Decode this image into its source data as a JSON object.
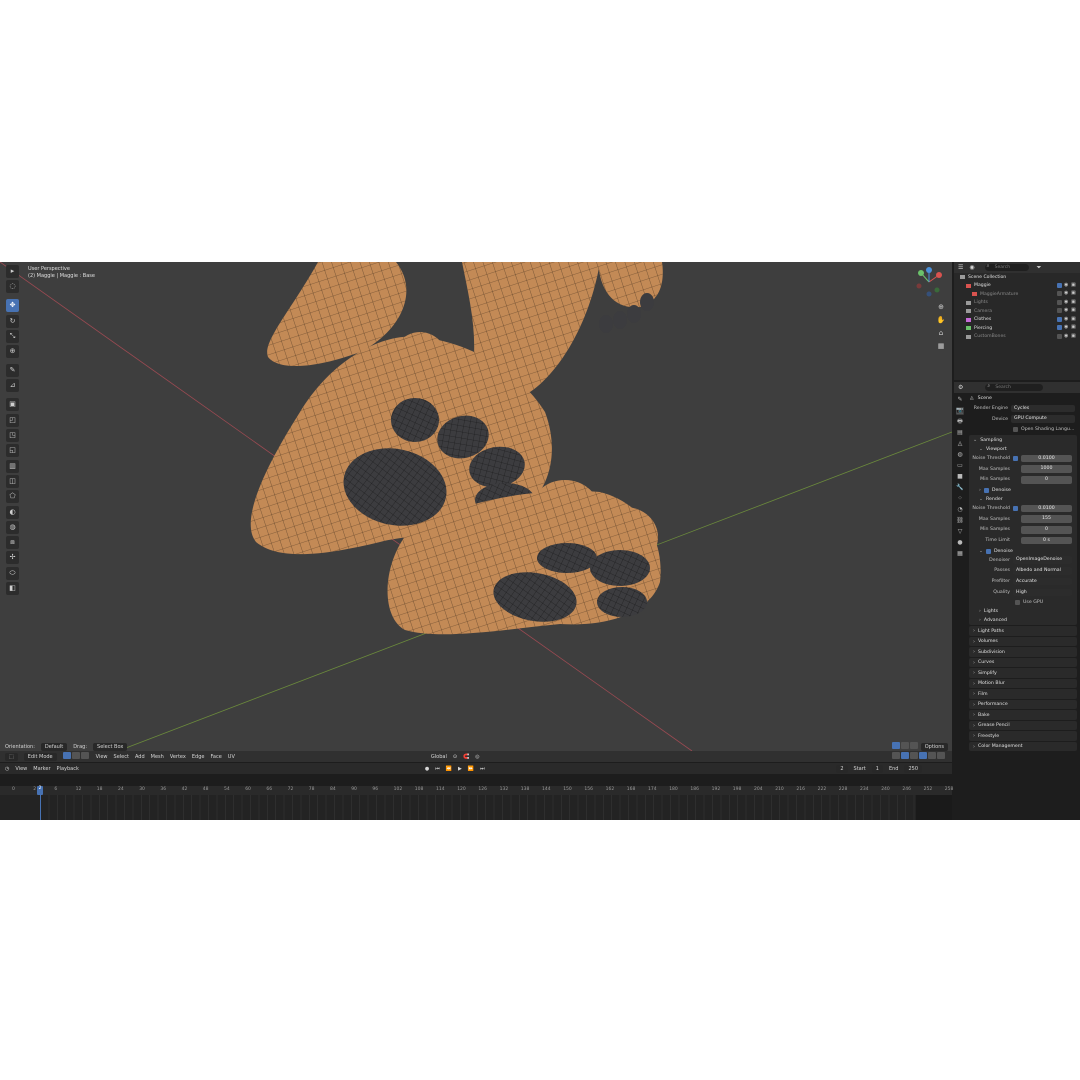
{
  "viewport": {
    "info_line1": "User Perspective",
    "info_line2": "(2) Maggie | Maggie : Base",
    "tools": [
      "cursor-icon",
      "circle-select-icon",
      "move-icon",
      "rotate-icon",
      "scale-icon",
      "transform-icon",
      "annotate-icon",
      "measure-icon",
      "add-cube-icon",
      "extrude-icon",
      "inset-icon",
      "bevel-icon",
      "loop-cut-icon",
      "knife-icon",
      "poly-build-icon",
      "spin-icon",
      "smooth-icon",
      "edge-slide-icon",
      "shrink-fatten-icon",
      "shear-icon",
      "rip-icon"
    ],
    "gizmo_axes": [
      "X",
      "Y",
      "Z"
    ]
  },
  "header": {
    "orientation_label": "Orientation:",
    "orientation_value": "Default",
    "drag_label": "Drag:",
    "drag_value": "Select Box",
    "options": "Options"
  },
  "edit_header": {
    "mode": "Edit Mode",
    "menus": [
      "View",
      "Select",
      "Add",
      "Mesh",
      "Vertex",
      "Edge",
      "Face",
      "UV"
    ],
    "transform_orientation": "Global"
  },
  "timeline_header": {
    "menus": [
      "View",
      "Marker",
      "Playback"
    ],
    "current_frame": "2",
    "start_label": "Start",
    "start_value": "1",
    "end_label": "End",
    "end_value": "250"
  },
  "ruler": {
    "current": "2",
    "labels": [
      "0",
      "2",
      "6",
      "12",
      "18",
      "24",
      "30",
      "36",
      "42",
      "48",
      "54",
      "60",
      "66",
      "72",
      "78",
      "84",
      "90",
      "96",
      "102",
      "108",
      "114",
      "120",
      "126",
      "132",
      "138",
      "144",
      "150",
      "156",
      "162",
      "168",
      "174",
      "180",
      "186",
      "192",
      "198",
      "204",
      "210",
      "216",
      "222",
      "228",
      "234",
      "240",
      "246",
      "252",
      "258"
    ]
  },
  "outliner": {
    "search_placeholder": "Search",
    "items": [
      {
        "label": "Scene Collection",
        "indent": 0,
        "dim": false,
        "color": "#9a9a9a"
      },
      {
        "label": "Maggie",
        "indent": 1,
        "dim": false,
        "color": "#d9534f"
      },
      {
        "label": "MaggieArmature",
        "indent": 2,
        "dim": true,
        "color": "#d9534f"
      },
      {
        "label": "Lights",
        "indent": 1,
        "dim": true,
        "color": "#9a9a9a"
      },
      {
        "label": "Camera",
        "indent": 1,
        "dim": true,
        "color": "#9a9a9a"
      },
      {
        "label": "Clothes",
        "indent": 1,
        "dim": false,
        "color": "#c86bd9"
      },
      {
        "label": "Piercing",
        "indent": 1,
        "dim": false,
        "color": "#6bc26b"
      },
      {
        "label": "CustomBones",
        "indent": 1,
        "dim": true,
        "color": "#9a9a9a"
      }
    ]
  },
  "properties": {
    "search_placeholder": "Search",
    "scene_label": "Scene",
    "render_engine_label": "Render Engine",
    "render_engine_value": "Cycles",
    "device_label": "Device",
    "device_value": "GPU Compute",
    "osl_label": "Open Shading Langu...",
    "sampling_label": "Sampling",
    "viewport_label": "Viewport",
    "vp_noise_label": "Noise Threshold",
    "vp_noise_value": "0.0100",
    "vp_max_label": "Max Samples",
    "vp_max_value": "1000",
    "vp_min_label": "Min Samples",
    "vp_min_value": "0",
    "vp_denoise_label": "Denoise",
    "render_label": "Render",
    "r_noise_label": "Noise Threshold",
    "r_noise_value": "0.0100",
    "r_max_label": "Max Samples",
    "r_max_value": "155",
    "r_min_label": "Min Samples",
    "r_min_value": "0",
    "r_time_label": "Time Limit",
    "r_time_value": "0 s",
    "r_denoise_label": "Denoise",
    "denoiser_label": "Denoiser",
    "denoiser_value": "OpenImageDenoise",
    "passes_label": "Passes",
    "passes_value": "Albedo and Normal",
    "prefilter_label": "Prefilter",
    "prefilter_value": "Accurate",
    "quality_label": "Quality",
    "quality_value": "High",
    "use_gpu_label": "Use GPU",
    "lights_sub": "Lights",
    "advanced_sub": "Advanced",
    "panels": [
      "Light Paths",
      "Volumes",
      "Subdivision",
      "Curves",
      "Simplify",
      "Motion Blur",
      "Film",
      "Performance",
      "Bake",
      "Grease Pencil",
      "Freestyle",
      "Color Management"
    ]
  }
}
